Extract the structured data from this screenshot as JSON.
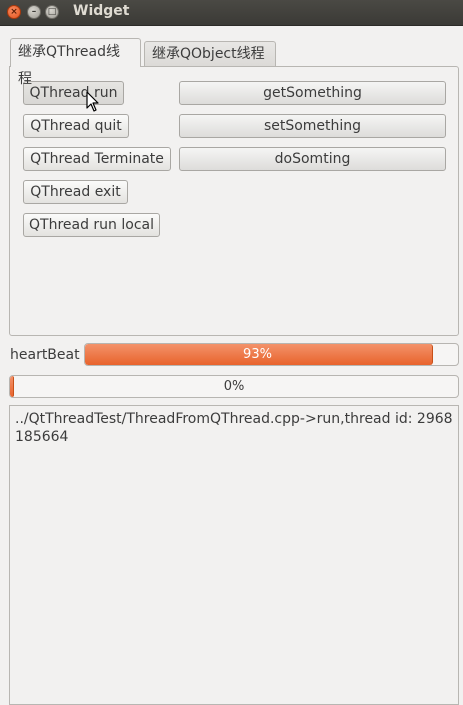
{
  "window": {
    "title": "Widget",
    "close_symbol": "×",
    "minimize_symbol": "–",
    "maximize_symbol": "□"
  },
  "tabs": [
    {
      "label": "继承QThread线程",
      "active": true
    },
    {
      "label": "继承QObject线程",
      "active": false
    }
  ],
  "buttons": {
    "qthread_run": "QThread run",
    "qthread_quit": "QThread quit",
    "qthread_terminate": "QThread Terminate",
    "qthread_exit": "QThread exit",
    "qthread_run_local": "QThread run local",
    "get_something": "getSomething",
    "set_something": "setSomething",
    "do_somting": "doSomting"
  },
  "heartbeat": {
    "label": "heartBeat",
    "value": 93,
    "text": "93%"
  },
  "progress2": {
    "value": 0,
    "text": "0%"
  },
  "output": {
    "text": "../QtThreadTest/ThreadFromQThread.cpp->run,thread id: 2968185664"
  },
  "colors": {
    "accent": "#e8632c",
    "titlebar": "#3b3a36",
    "window_bg": "#f2f1f0"
  },
  "icons": {
    "close": "close-icon",
    "minimize": "minimize-icon",
    "maximize": "maximize-icon",
    "cursor": "mouse-pointer-icon"
  }
}
